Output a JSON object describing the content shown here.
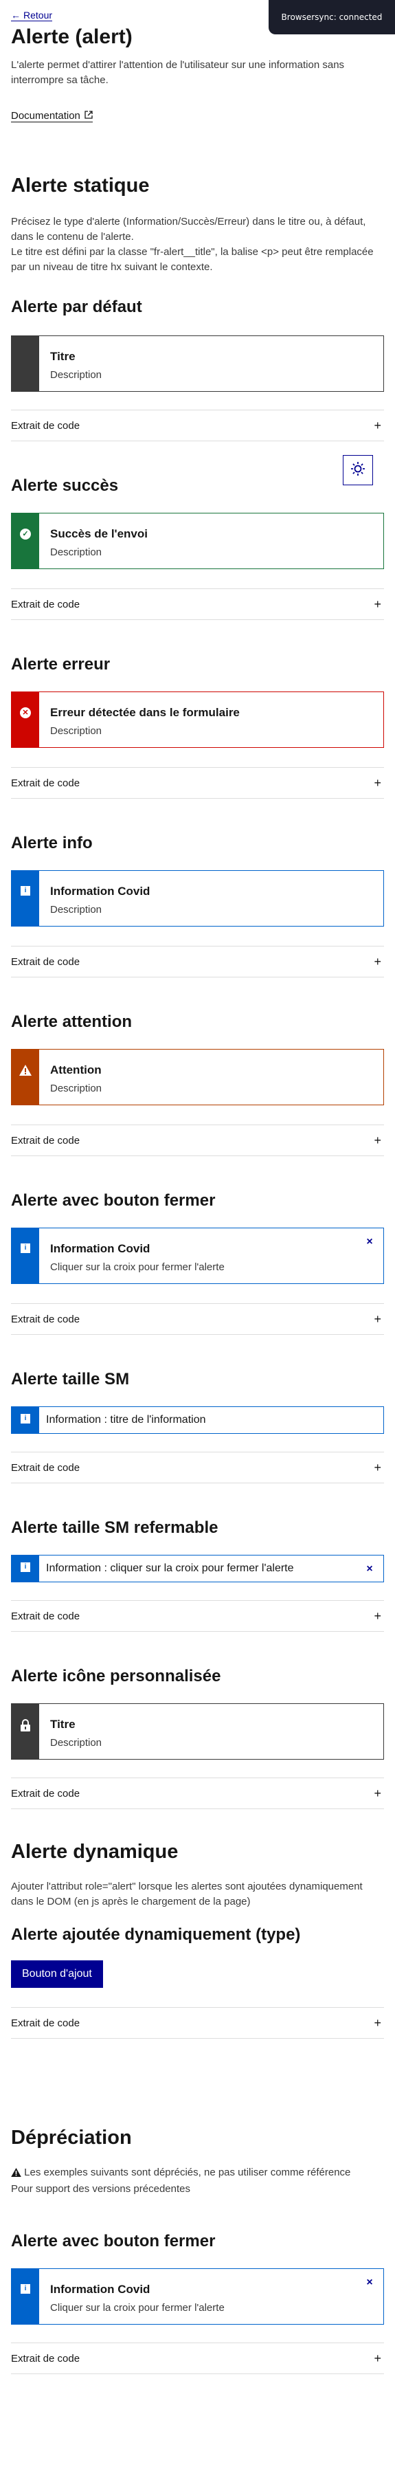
{
  "nav": {
    "back_label": "Retour"
  },
  "toast": {
    "text": "Browsersync: connected"
  },
  "header": {
    "title": "Alerte (alert)",
    "lead": "L'alerte permet d'attirer l'attention de l'utilisateur sur une information sans interrompre sa tâche.",
    "doc_link": "Documentation"
  },
  "static": {
    "title": "Alerte statique",
    "intro": "Précisez le type d'alerte (Information/Succès/Erreur) dans le titre ou, à défaut, dans le contenu de l'alerte.\nLe titre est défini par la classe \"fr-alert__title\", la balise <p> peut être remplacée par un niveau de titre hx suivant le contexte."
  },
  "code_label": "Extrait de code",
  "code_toggle": "+",
  "close_glyph": "×",
  "examples": [
    {
      "heading": "Alerte par défaut",
      "title": "Titre",
      "text": "Description"
    },
    {
      "heading": "Alerte succès",
      "title": "Succès de l'envoi",
      "text": "Description"
    },
    {
      "heading": "Alerte erreur",
      "title": "Erreur détectée dans le formulaire",
      "text": "Description"
    },
    {
      "heading": "Alerte info",
      "title": "Information Covid",
      "text": "Description"
    },
    {
      "heading": "Alerte attention",
      "title": "Attention",
      "text": "Description"
    },
    {
      "heading": "Alerte avec bouton fermer",
      "title": "Information Covid",
      "text": "Cliquer sur la croix pour fermer l'alerte"
    },
    {
      "heading": "Alerte taille SM",
      "text": "Information : titre de l'information"
    },
    {
      "heading": "Alerte taille SM refermable",
      "text": "Information : cliquer sur la croix pour fermer l'alerte"
    },
    {
      "heading": "Alerte icône personnalisée",
      "title": "Titre",
      "text": "Description"
    }
  ],
  "dynamic": {
    "title": "Alerte dynamique",
    "intro": "Ajouter l'attribut role=\"alert\" lorsque les alertes sont ajoutées dynamiquement dans le DOM (en js après le chargement de la page)",
    "subheading": "Alerte ajoutée dynamiquement (type)",
    "button": "Bouton d'ajout"
  },
  "deprecation": {
    "title": "Dépréciation",
    "notice": "Les exemples suivants sont dépréciés, ne pas utiliser comme référence",
    "notice2": "Pour support des versions précedentes",
    "example": {
      "heading": "Alerte avec bouton fermer",
      "title": "Information Covid",
      "text": "Cliquer sur la croix pour fermer l'alerte"
    }
  },
  "colors": {
    "default": "#3a3a3a",
    "success": "#18753c",
    "error": "#ce0500",
    "info": "#0063cb",
    "warning": "#b34000",
    "primary": "#000091"
  }
}
